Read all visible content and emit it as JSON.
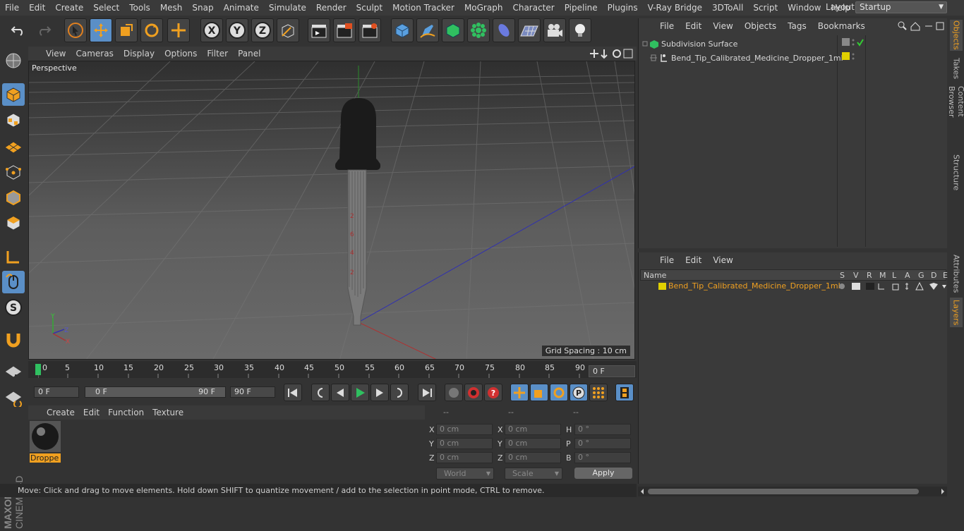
{
  "menu": [
    "File",
    "Edit",
    "Create",
    "Select",
    "Tools",
    "Mesh",
    "Snap",
    "Animate",
    "Simulate",
    "Render",
    "Sculpt",
    "Motion Tracker",
    "MoGraph",
    "Character",
    "Pipeline",
    "Plugins",
    "V-Ray Bridge",
    "3DToAll",
    "Script",
    "Window",
    "Help"
  ],
  "layout": {
    "label": "Layout:",
    "value": "Startup"
  },
  "viewport": {
    "menu": [
      "View",
      "Cameras",
      "Display",
      "Options",
      "Filter",
      "Panel"
    ],
    "label": "Perspective",
    "grid_spacing": "Grid Spacing : 10 cm"
  },
  "timeline": {
    "ticks": [
      "0",
      "5",
      "10",
      "15",
      "20",
      "25",
      "30",
      "35",
      "40",
      "45",
      "50",
      "55",
      "60",
      "65",
      "70",
      "75",
      "80",
      "85",
      "90"
    ],
    "frame": "0 F"
  },
  "controls": {
    "start": "0 F",
    "range_start": "0 F",
    "range_end": "90 F",
    "end": "90 F"
  },
  "materials": {
    "menu": [
      "Create",
      "Edit",
      "Function",
      "Texture"
    ],
    "items": [
      {
        "label": "Droppe"
      }
    ]
  },
  "coords": {
    "headers": [
      "--",
      "--",
      "--"
    ],
    "rows": [
      {
        "l1": "X",
        "v1": "0 cm",
        "l2": "X",
        "v2": "0 cm",
        "l3": "H",
        "v3": "0 °"
      },
      {
        "l1": "Y",
        "v1": "0 cm",
        "l2": "Y",
        "v2": "0 cm",
        "l3": "P",
        "v3": "0 °"
      },
      {
        "l1": "Z",
        "v1": "0 cm",
        "l2": "Z",
        "v2": "0 cm",
        "l3": "B",
        "v3": "0 °"
      }
    ],
    "world": "World",
    "scale": "Scale",
    "apply": "Apply"
  },
  "status": "Move: Click and drag to move elements. Hold down SHIFT to quantize movement / add to the selection in point mode, CTRL to remove.",
  "objects": {
    "menu": [
      "File",
      "Edit",
      "View",
      "Objects",
      "Tags",
      "Bookmarks"
    ],
    "items": [
      {
        "name": "Subdivision Surface"
      },
      {
        "name": "Bend_Tip_Calibrated_Medicine_Dropper_1ml"
      }
    ]
  },
  "layers": {
    "menu": [
      "File",
      "Edit",
      "View"
    ],
    "columns": [
      "Name",
      "S",
      "V",
      "R",
      "M",
      "L",
      "A",
      "G",
      "D",
      "E"
    ],
    "items": [
      {
        "name": "Bend_Tip_Calibrated_Medicine_Dropper_1ml"
      }
    ]
  },
  "side_tabs": [
    "Objects",
    "Takes",
    "Content Browser",
    "Structure",
    "Attributes",
    "Layers"
  ],
  "logo": {
    "brand": "MAXON",
    "product": "CINEMA 4D"
  },
  "colors": {
    "accent": "#5a8fc7",
    "orange": "#f0a020",
    "layer_yellow": "#e0d000"
  }
}
